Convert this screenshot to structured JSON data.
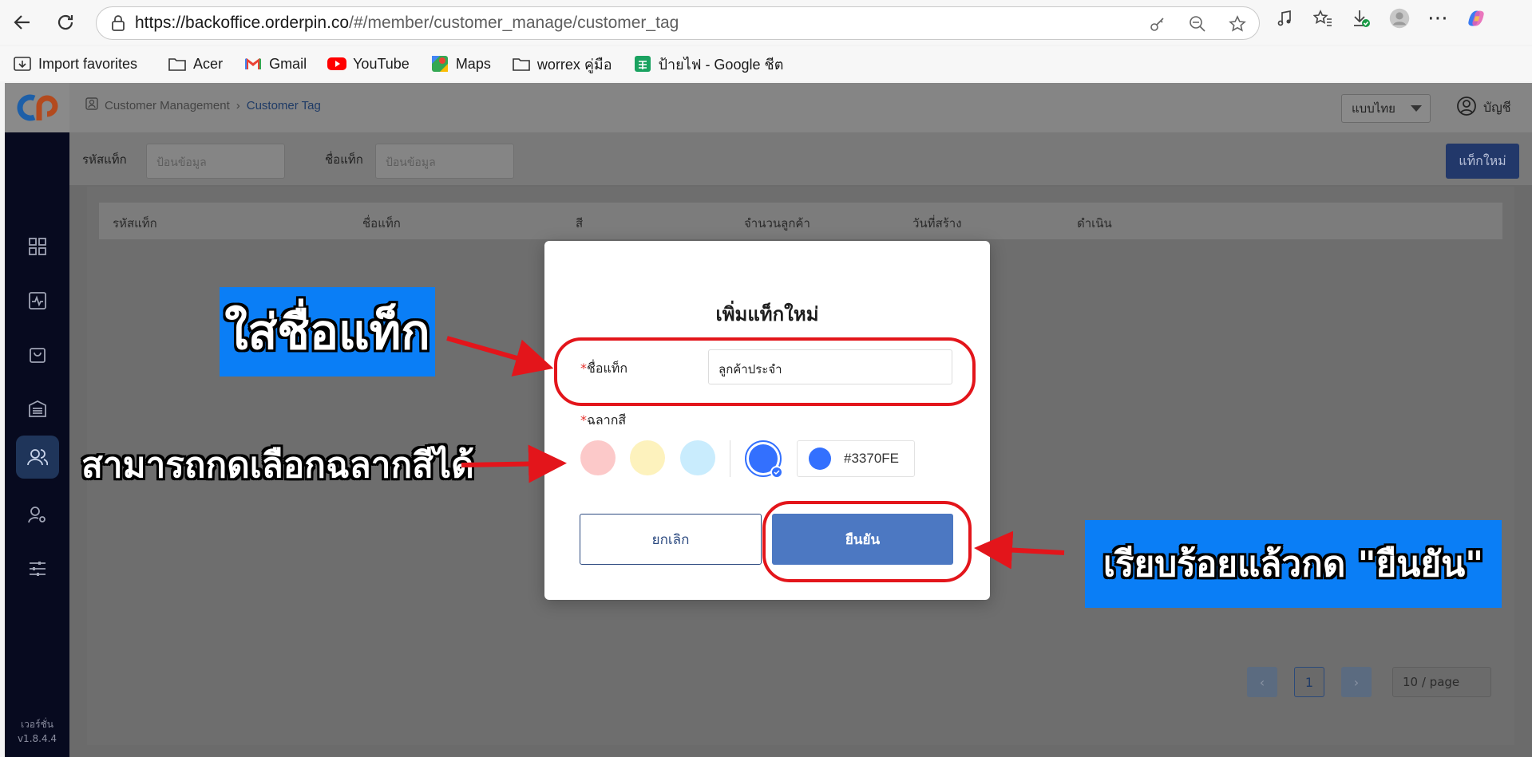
{
  "browser": {
    "url_host": "https://backoffice.orderpin.co",
    "url_path": "/#/member/customer_manage/customer_tag",
    "bookmarks": [
      {
        "label": "Import favorites",
        "icon": "import-icon"
      },
      {
        "label": "Acer",
        "icon": "folder-icon"
      },
      {
        "label": "Gmail",
        "icon": "gmail-icon"
      },
      {
        "label": "YouTube",
        "icon": "youtube-icon"
      },
      {
        "label": "Maps",
        "icon": "maps-icon"
      },
      {
        "label": "worrex คู่มือ",
        "icon": "folder-icon"
      },
      {
        "label": "ป้ายไฟ - Google ชีต",
        "icon": "sheets-icon"
      }
    ]
  },
  "app": {
    "breadcrumb": {
      "parent": "Customer Management",
      "current": "Customer Tag"
    },
    "language": "แบบไทย",
    "account_label": "บัญชี",
    "version_label": "เวอร์ชั่น",
    "version": "v1.8.4.4",
    "filters": {
      "tag_code_label": "รหัสแท็ก",
      "tag_code_placeholder": "ป้อนข้อมูล",
      "tag_name_label": "ชื่อแท็ก",
      "tag_name_placeholder": "ป้อนข้อมูล",
      "new_tag_button": "แท็กใหม่"
    },
    "table_columns": [
      "รหัสแท็ก",
      "ชื่อแท็ก",
      "สี",
      "จำนวนลูกค้า",
      "วันที่สร้าง",
      "ดำเนิน"
    ],
    "pagination": {
      "prev": "‹",
      "current_page": "1",
      "next": "›",
      "page_size": "10 / page"
    }
  },
  "modal": {
    "title": "เพิ่มแท็กใหม่",
    "name_label": "ชื่อแท็ก",
    "name_value": "ลูกค้าประจำ",
    "color_label": "ฉลากสี",
    "swatches": [
      "#fcc9c9",
      "#fdf2bd",
      "#c9ecfd"
    ],
    "selected_color": "#3370FE",
    "cancel_label": "ยกเลิก",
    "confirm_label": "ยืนยัน",
    "required_mark": "*"
  },
  "annotations": {
    "enter_name": "ใส่ชื่อแท็ก",
    "choose_color": "สามารถกดเลือกฉลากสีได้",
    "confirm_hint": "เรียบร้อยแล้วกด \"ยืนยัน\""
  }
}
